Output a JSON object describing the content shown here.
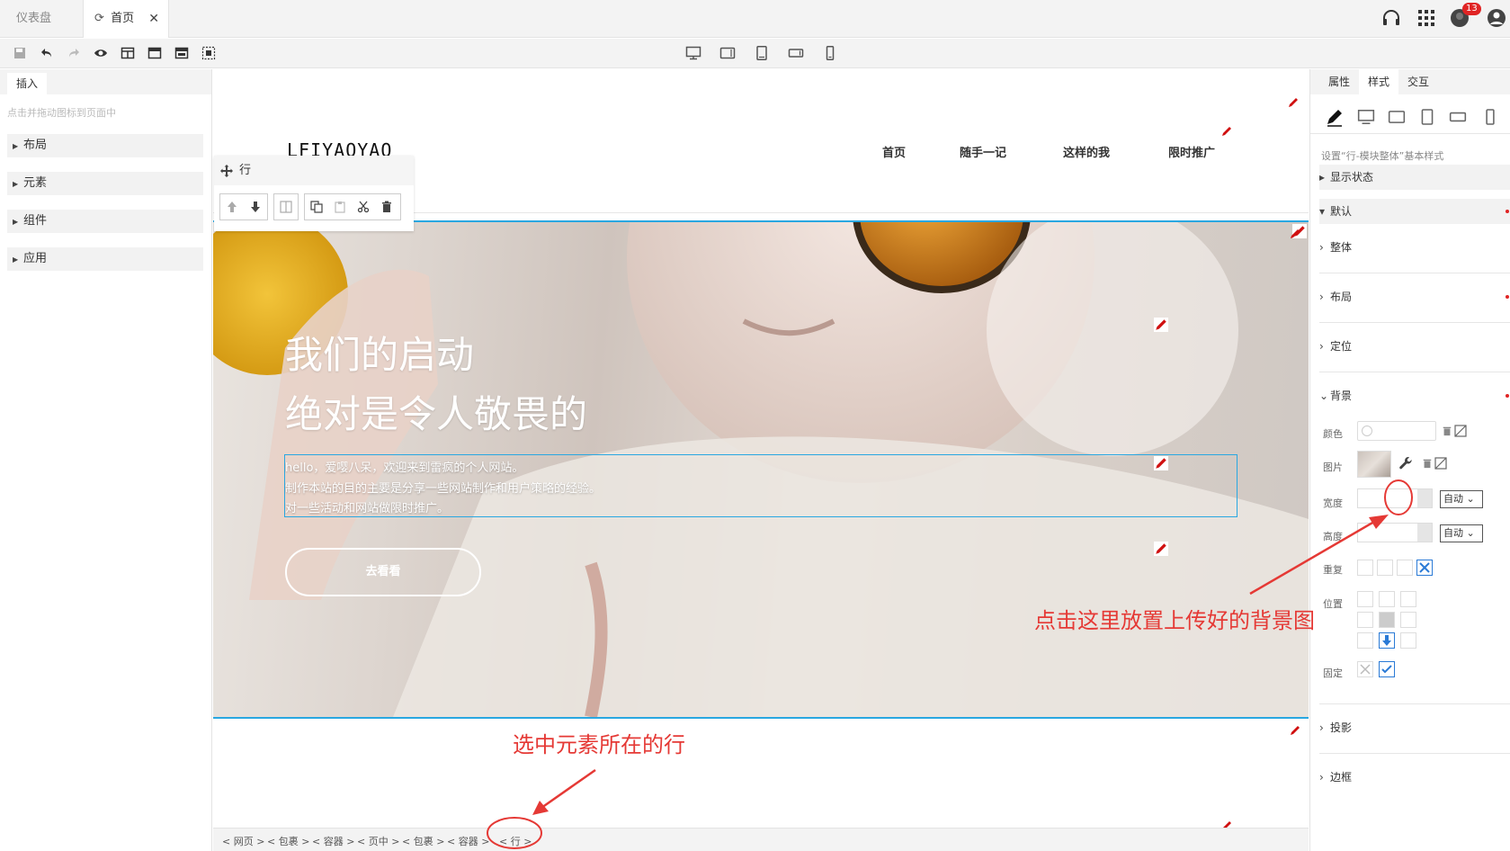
{
  "tabs": {
    "dashboard": "仪表盘",
    "home": "首页"
  },
  "topbar": {
    "notification_count": "13",
    "icons": [
      "headset-icon",
      "apps-grid-icon",
      "user-avatar-icon",
      "account-icon"
    ]
  },
  "toolbar": {
    "icons": [
      "save-icon",
      "undo-icon",
      "redo-icon",
      "preview-eye-icon",
      "layout-split-icon",
      "layout-header-icon",
      "layout-full-icon",
      "select-region-icon"
    ],
    "device_icons": [
      "desktop-icon",
      "tablet-landscape-icon",
      "tablet-portrait-icon",
      "phone-landscape-icon",
      "phone-portrait-icon"
    ]
  },
  "left_panel": {
    "tab": "插入",
    "hint": "点击并拖动图标到页面中",
    "sections": [
      "布局",
      "元素",
      "组件",
      "应用"
    ]
  },
  "site": {
    "logo": "LFIYAOYAO",
    "nav": [
      "首页",
      "随手一记",
      "这样的我",
      "限时推广"
    ],
    "hero_title_1": "我们的启动",
    "hero_title_2": "绝对是令人敬畏的",
    "hero_lines": [
      "hello，爱嘤八呆，欢迎来到雷疯的个人网站。",
      "制作本站的目的主要是分享一些网站制作和用户策略的经验。",
      "对一些活动和网站做限时推广。"
    ],
    "hero_button": "去看看"
  },
  "row_popup": {
    "title": "行"
  },
  "breadcrumb": [
    "< 网页 >",
    "< 包裹 >",
    "< 容器 >",
    "< 页中 >",
    "< 包裹 >",
    "< 容器 >",
    "< 行 >"
  ],
  "right_panel": {
    "tabs": [
      "属性",
      "样式",
      "交互"
    ],
    "active_tab": "样式",
    "subtitle": "设置“行-模块整体”基本样式",
    "display_state": "显示状态",
    "default": "默认",
    "sections": [
      "整体",
      "布局",
      "定位",
      "背景"
    ],
    "bg_fields": {
      "color": "颜色",
      "image": "图片",
      "width": "宽度",
      "height": "高度",
      "repeat": "重复",
      "position": "位置",
      "fixed": "固定",
      "auto": "自动"
    },
    "more_sections": [
      "投影",
      "边框"
    ]
  },
  "annotations": {
    "upload_hint": "点击这里放置上传好的背景图",
    "select_row_hint": "选中元素所在的行"
  },
  "colors": {
    "accent_blue": "#29a7e1",
    "annotation_red": "#e53935"
  }
}
